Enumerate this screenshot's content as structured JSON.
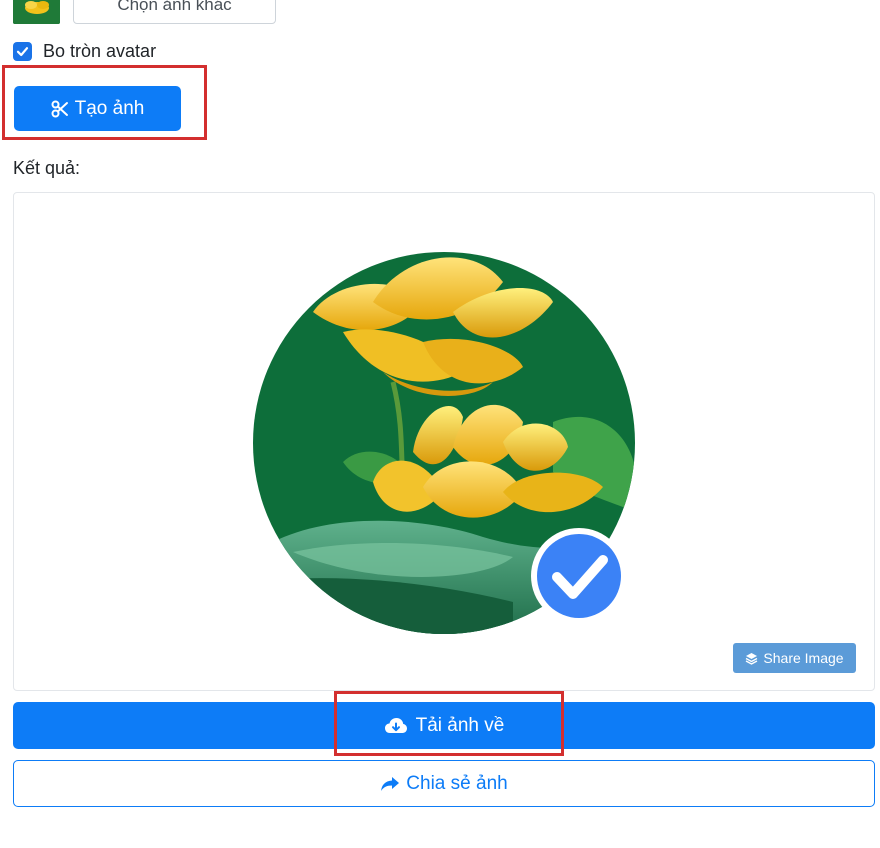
{
  "upload": {
    "choose_label": "Chọn ảnh khác"
  },
  "options": {
    "round_avatar_label": "Bo tròn avatar",
    "round_avatar_checked": true
  },
  "actions": {
    "make_label": "Tạo ảnh",
    "make_icon": "scissors-icon"
  },
  "result": {
    "label": "Kết quả:",
    "share_image_label": "Share Image",
    "share_image_icon": "layers-icon",
    "badge_icon": "check-badge-icon"
  },
  "footer": {
    "download_label": "Tải ảnh về",
    "download_icon": "cloud-download-icon",
    "share_label": "Chia sẻ ảnh",
    "share_icon": "share-arrow-icon"
  },
  "colors": {
    "primary": "#0d7cf7",
    "highlight": "#d32f2f",
    "share_image_bg": "#5b9bd8",
    "badge": "#3b82f6"
  }
}
